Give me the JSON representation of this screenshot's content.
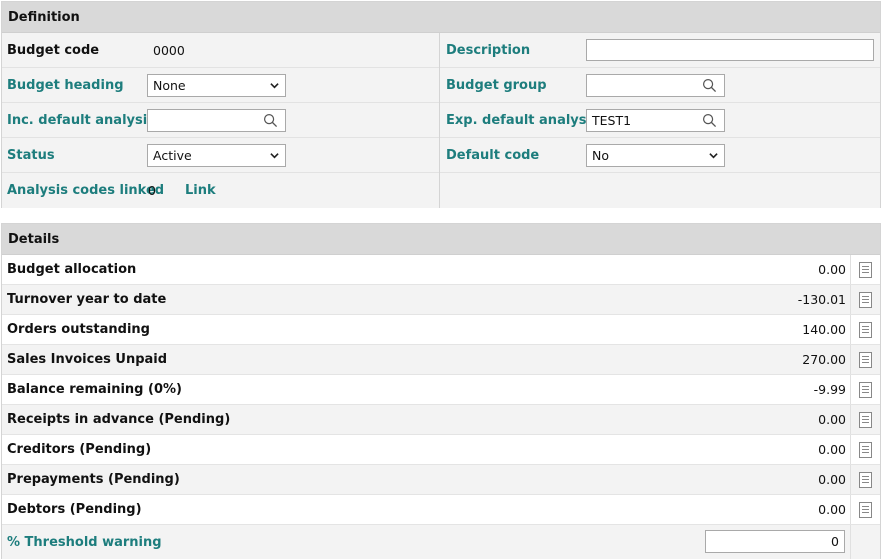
{
  "definition": {
    "header": "Definition",
    "left": {
      "budget_code": {
        "label": "Budget code",
        "value": "0000"
      },
      "budget_heading": {
        "label": "Budget heading",
        "value": "None"
      },
      "inc_default_analysis": {
        "label": "Inc. default analysis",
        "value": ""
      },
      "status": {
        "label": "Status",
        "value": "Active"
      },
      "analysis_codes_linked": {
        "label": "Analysis codes linked",
        "count": "0",
        "link_label": "Link"
      }
    },
    "right": {
      "description": {
        "label": "Description",
        "value": ""
      },
      "budget_group": {
        "label": "Budget group",
        "value": ""
      },
      "exp_default_analysis": {
        "label": "Exp. default analysis",
        "value": "TEST1"
      },
      "default_code": {
        "label": "Default code",
        "value": "No"
      }
    }
  },
  "details": {
    "header": "Details",
    "rows": [
      {
        "label": "Budget allocation",
        "value": "0.00"
      },
      {
        "label": "Turnover year to date",
        "value": "-130.01"
      },
      {
        "label": "Orders outstanding",
        "value": "140.00"
      },
      {
        "label": "Sales Invoices Unpaid",
        "value": "270.00"
      },
      {
        "label": "Balance remaining (0%)",
        "value": "-9.99"
      },
      {
        "label": "Receipts in advance (Pending)",
        "value": "0.00"
      },
      {
        "label": "Creditors (Pending)",
        "value": "0.00"
      },
      {
        "label": "Prepayments (Pending)",
        "value": "0.00"
      },
      {
        "label": "Debtors (Pending)",
        "value": "0.00"
      }
    ],
    "threshold": {
      "label": "% Threshold warning",
      "value": "0"
    }
  },
  "icons": {
    "select": "chevron-down-icon",
    "lookup": "search-icon",
    "row_action": "document-icon"
  },
  "colors": {
    "accent_label": "#1d7d7d",
    "header_bg": "#d9d9d9",
    "row_alt_bg": "#f3f3f3"
  }
}
